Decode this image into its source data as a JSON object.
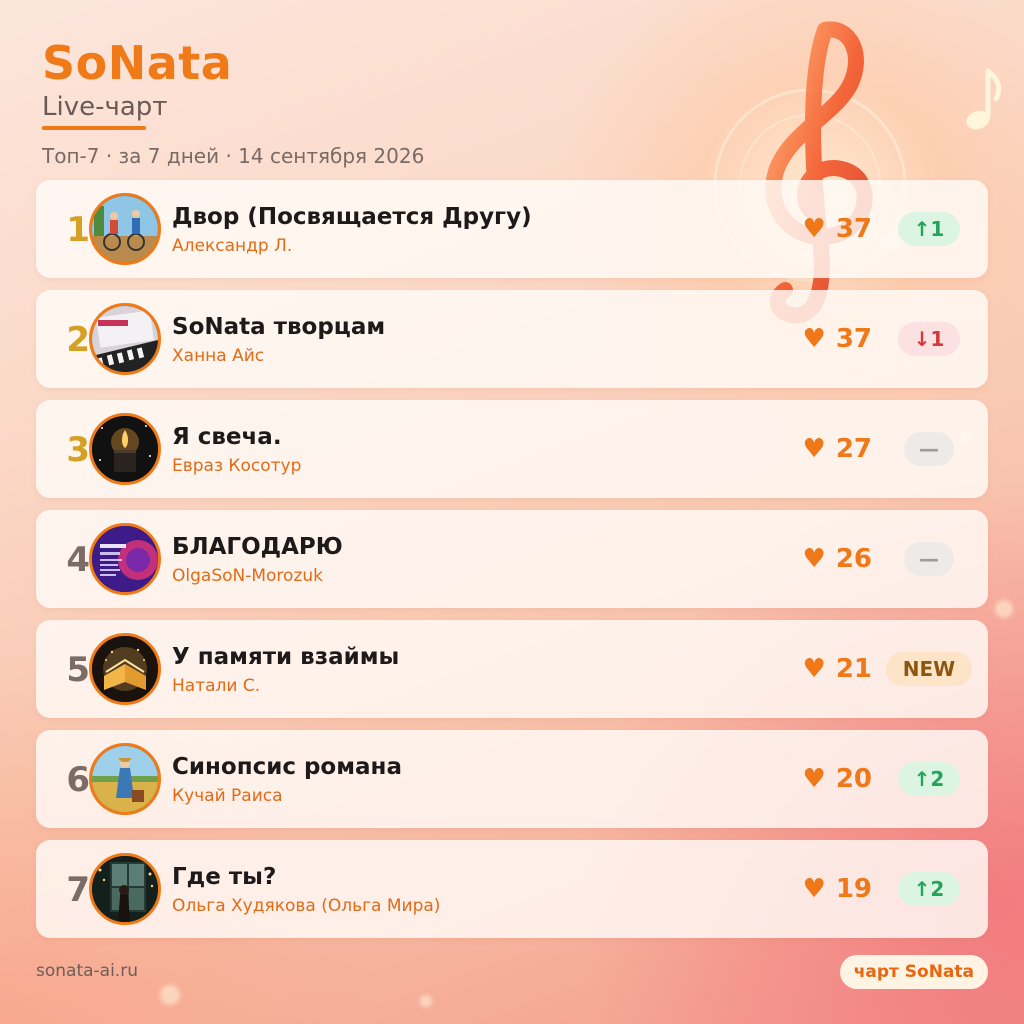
{
  "header": {
    "brand": "SoNata",
    "subtitle": "Live-чарт",
    "meta": "Топ-7 · за 7 дней · 14 сентября 2026"
  },
  "chart_rows": [
    {
      "rank": "1",
      "title": "Двор (Посвящается Другу)",
      "artist": "Александр Л.",
      "likes": "37",
      "change_type": "up",
      "change_label": "↑1",
      "cover": "kids-on-bikes-cover"
    },
    {
      "rank": "2",
      "title": "SoNata творцам",
      "artist": "Ханна Айс",
      "likes": "37",
      "change_type": "down",
      "change_label": "↓1",
      "cover": "piano-sheet-cover"
    },
    {
      "rank": "3",
      "title": "Я свеча.",
      "artist": "Евраз Косотур",
      "likes": "27",
      "change_type": "same",
      "change_label": "—",
      "cover": "candle-cover"
    },
    {
      "rank": "4",
      "title": "БЛАГОДАРЮ",
      "artist": "OlgaSoN-Morozuk",
      "likes": "26",
      "change_type": "same",
      "change_label": "—",
      "cover": "purple-album-cover"
    },
    {
      "rank": "5",
      "title": "У памяти взаймы",
      "artist": "Натали С.",
      "likes": "21",
      "change_type": "new",
      "change_label": "NEW",
      "cover": "glowing-book-cover"
    },
    {
      "rank": "6",
      "title": "Синопсис романа",
      "artist": "Кучай Раиса",
      "likes": "20",
      "change_type": "up",
      "change_label": "↑2",
      "cover": "girl-with-suitcase-cover"
    },
    {
      "rank": "7",
      "title": "Где ты?",
      "artist": "Ольга Худякова (Ольга Мира)",
      "likes": "19",
      "change_type": "up",
      "change_label": "↑2",
      "cover": "girl-at-window-cover"
    }
  ],
  "footer": {
    "url": "sonata-ai.ru",
    "tag": "чарт SoNata"
  },
  "icons": {
    "like": "♥",
    "decoration": [
      "treble-clef-icon",
      "music-note-icon"
    ]
  },
  "colors": {
    "accent": "#f07a18",
    "gold_rank": "#d4a126",
    "up": "#26a35a",
    "down": "#d23a3a"
  }
}
